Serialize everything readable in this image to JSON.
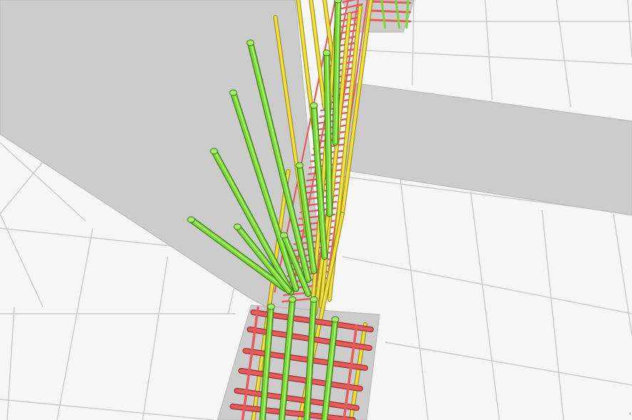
{
  "viewport": {
    "view_type": "3D rebar detailing view",
    "background_color": "#f6f6f6",
    "grid_line_color": "#c9c9c9",
    "concrete_color": "#cccccc",
    "concrete_edge_color": "#b4b4b4"
  },
  "rebar_colors": {
    "stirrup_ties": "#e55b5b",
    "main_bars": "#f0e040",
    "dowel_bars": "#7ad836"
  },
  "corner_mark": "'"
}
